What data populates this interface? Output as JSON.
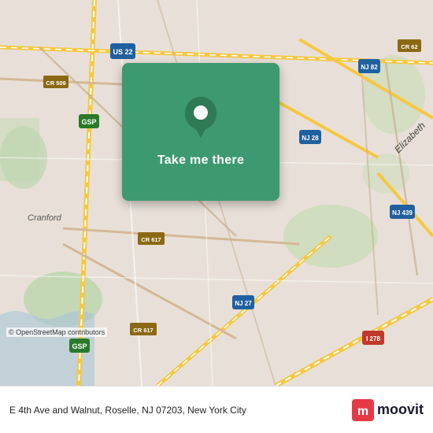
{
  "map": {
    "background_color": "#e8e0d8",
    "center_lat": 40.65,
    "center_lng": -74.26
  },
  "card": {
    "label": "Take me there",
    "background_color": "#3d9970"
  },
  "attribution": {
    "text": "© OpenStreetMap contributors"
  },
  "bottom_bar": {
    "address": "E 4th Ave and Walnut, Roselle, NJ 07203, New York\nCity",
    "logo_text": "moovit"
  },
  "road_labels": [
    "US 22",
    "CR 62",
    "NJ 82",
    "CR 509",
    "GSP",
    "NJ 28",
    "Cranford",
    "CR 617",
    "NJ 27",
    "NJ 439",
    "I 278",
    "I 278",
    "CR 617",
    "NJ 27",
    "GSP"
  ]
}
